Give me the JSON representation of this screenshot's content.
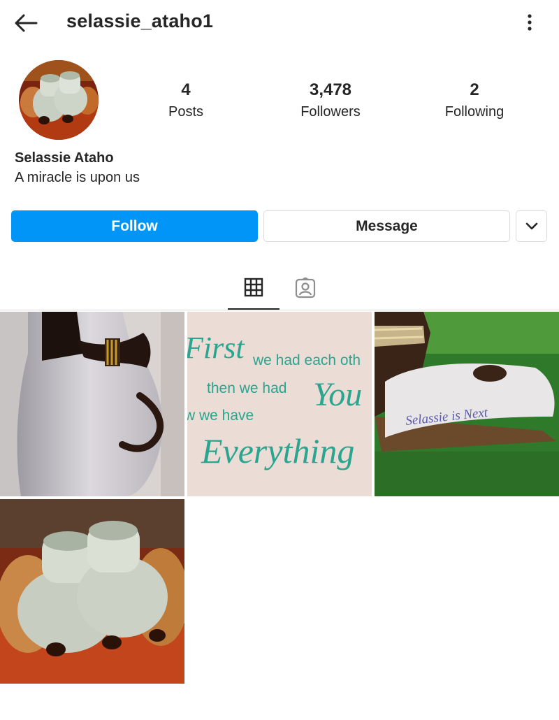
{
  "header": {
    "username": "selassie_ataho1",
    "back_icon": "arrow-left-icon",
    "more_icon": "more-vertical-icon"
  },
  "profile": {
    "full_name": "Selassie Ataho",
    "bio": "A miracle is upon us",
    "stats": [
      {
        "value": "4",
        "label": "Posts"
      },
      {
        "value": "3,478",
        "label": "Followers"
      },
      {
        "value": "2",
        "label": "Following"
      }
    ]
  },
  "actions": {
    "follow_label": "Follow",
    "message_label": "Message",
    "dropdown_icon": "chevron-down-icon"
  },
  "tabs": [
    {
      "name": "grid",
      "icon": "grid-icon",
      "active": true
    },
    {
      "name": "tagged",
      "icon": "tagged-person-icon",
      "active": false
    }
  ],
  "posts": [
    {
      "subject": "pregnant belly"
    },
    {
      "subject": "quote sign",
      "lines": [
        "First",
        "we had each oth",
        "then we had",
        "You",
        "w we have",
        "Everything"
      ]
    },
    {
      "subject": "sandal on grass",
      "handwriting": "Selassie is Next"
    },
    {
      "subject": "knitted baby booties"
    }
  ],
  "colors": {
    "accent": "#0095f6",
    "text": "#262626",
    "border": "#dbdbdb",
    "quote_teal": "#2aa58f"
  }
}
